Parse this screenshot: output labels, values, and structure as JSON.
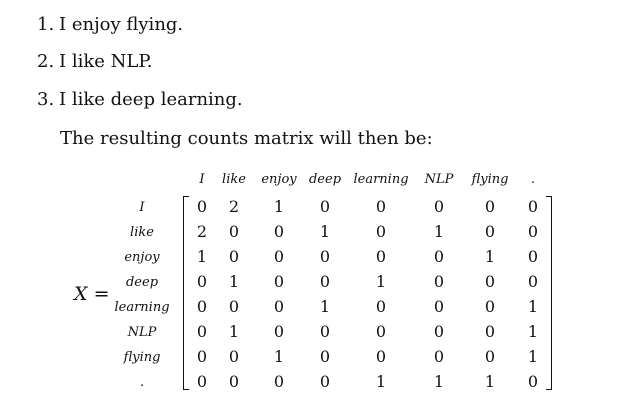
{
  "list": [
    {
      "number": "1.",
      "text": "I enjoy flying."
    },
    {
      "number": "2.",
      "text": "I like NLP."
    },
    {
      "number": "3.",
      "text": "I like deep learning."
    }
  ],
  "paragraph": "The resulting counts matrix will then be:",
  "matrix": {
    "label_var": "X",
    "label_eq": "=",
    "column_headers": [
      "I",
      "like",
      "enjoy",
      "deep",
      "learning",
      "NLP",
      "flying",
      "."
    ],
    "row_headers": [
      "I",
      "like",
      "enjoy",
      "deep",
      "learning",
      "NLP",
      "flying",
      "."
    ],
    "rows": [
      [
        "0",
        "2",
        "1",
        "0",
        "0",
        "0",
        "0",
        "0"
      ],
      [
        "2",
        "0",
        "0",
        "1",
        "0",
        "1",
        "0",
        "0"
      ],
      [
        "1",
        "0",
        "0",
        "0",
        "0",
        "0",
        "1",
        "0"
      ],
      [
        "0",
        "1",
        "0",
        "0",
        "1",
        "0",
        "0",
        "0"
      ],
      [
        "0",
        "0",
        "0",
        "1",
        "0",
        "0",
        "0",
        "1"
      ],
      [
        "0",
        "1",
        "0",
        "0",
        "0",
        "0",
        "0",
        "1"
      ],
      [
        "0",
        "0",
        "1",
        "0",
        "0",
        "0",
        "0",
        "1"
      ],
      [
        "0",
        "0",
        "0",
        "0",
        "1",
        "1",
        "1",
        "0"
      ]
    ]
  }
}
